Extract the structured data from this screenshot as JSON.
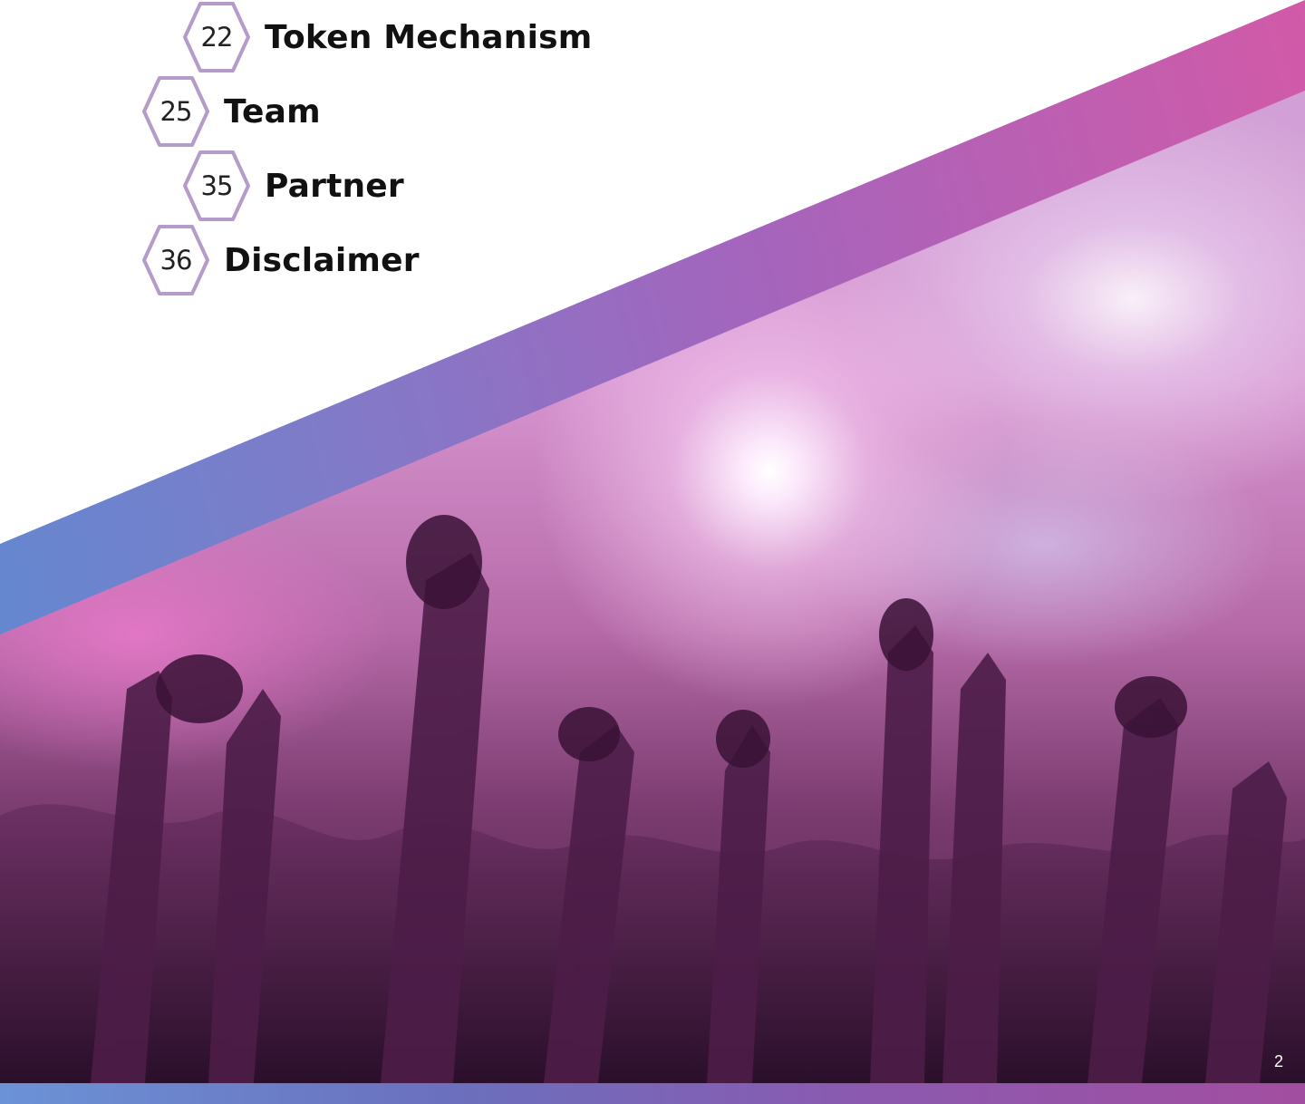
{
  "toc": [
    {
      "page": "22",
      "title": "Token Mechanism"
    },
    {
      "page": "25",
      "title": "Team"
    },
    {
      "page": "35",
      "title": "Partner"
    },
    {
      "page": "36",
      "title": "Disclaimer"
    }
  ],
  "page_number": "2",
  "colors": {
    "stripe_start": "#5b8bd2",
    "stripe_end": "#d25aa8",
    "hex_border": "#b49bc9"
  },
  "icons": [
    "hexagon-badge-icon"
  ]
}
